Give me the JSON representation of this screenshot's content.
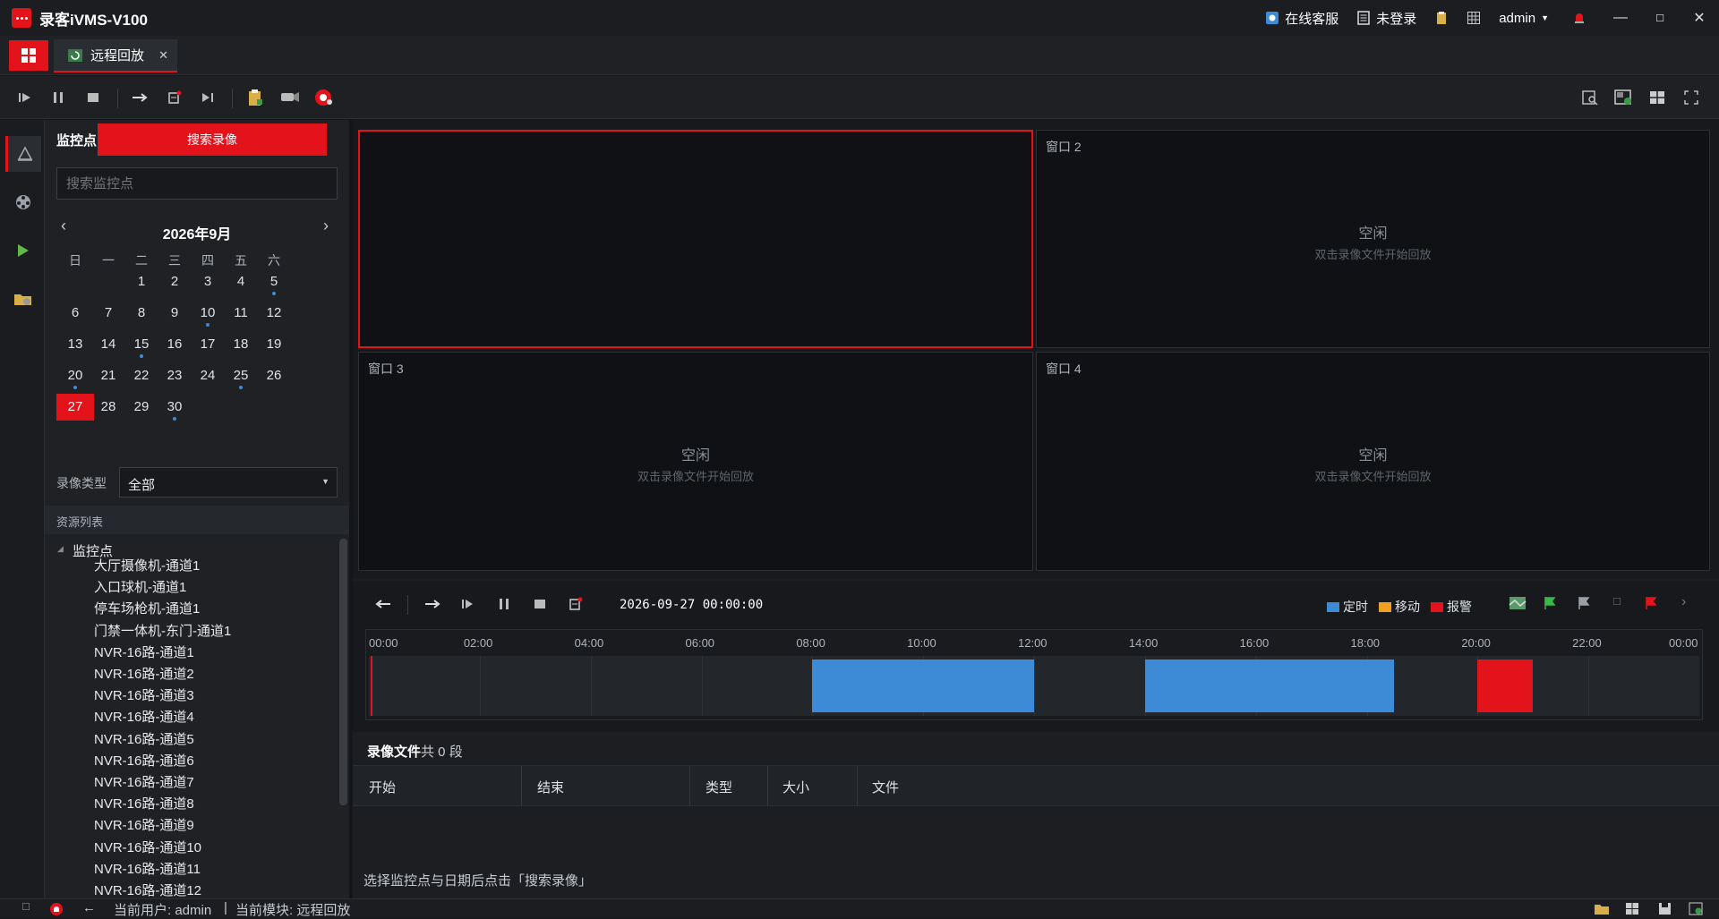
{
  "app": {
    "title": "录客iVMS-V100"
  },
  "titlebar": {
    "support": "在线客服",
    "login": "未登录",
    "user": "admin"
  },
  "tabs": [
    {
      "label": "远程回放"
    }
  ],
  "sidebar": {
    "header_label": "监控点",
    "search_button": "搜索录像",
    "search_placeholder": "搜索监控点",
    "calendar": {
      "month_title": "2026年9月",
      "weekdays": [
        "日",
        "一",
        "二",
        "三",
        "四",
        "五",
        "六"
      ],
      "days": [
        "1",
        "2",
        "3",
        "4",
        "5",
        "6",
        "7",
        "8",
        "9",
        "10",
        "11",
        "12",
        "13",
        "14",
        "15",
        "16",
        "17",
        "18",
        "19",
        "20",
        "21",
        "22",
        "23",
        "24",
        "25",
        "26",
        "27",
        "28",
        "29",
        "30"
      ],
      "selected_day": "27",
      "days_with_records": [
        "5",
        "10",
        "15",
        "20",
        "25",
        "30"
      ]
    },
    "record_type_label": "录像类型",
    "record_type_value": "全部",
    "resource_list_title": "资源列表",
    "tree_root": "监控点",
    "tree_items": [
      "大厅摄像机-通道1",
      "入口球机-通道1",
      "停车场枪机-通道1",
      "门禁一体机-东门-通道1",
      "NVR-16路-通道1",
      "NVR-16路-通道2",
      "NVR-16路-通道3",
      "NVR-16路-通道4",
      "NVR-16路-通道5",
      "NVR-16路-通道6",
      "NVR-16路-通道7",
      "NVR-16路-通道8",
      "NVR-16路-通道9",
      "NVR-16路-通道10",
      "NVR-16路-通道11",
      "NVR-16路-通道12"
    ]
  },
  "video": {
    "windows": [
      {
        "label": ""
      },
      {
        "label": "窗口 2",
        "idle": "空闲",
        "hint": "双击录像文件开始回放"
      },
      {
        "label": "窗口 3",
        "idle": "空闲",
        "hint": "双击录像文件开始回放"
      },
      {
        "label": "窗口 4",
        "idle": "空闲",
        "hint": "双击录像文件开始回放"
      }
    ]
  },
  "playback": {
    "datetime": "2026-09-27 00:00:00",
    "legend": [
      {
        "label": "定时",
        "color": "#3d8bd6"
      },
      {
        "label": "移动",
        "color": "#f0a020"
      },
      {
        "label": "报警",
        "color": "#e3131c"
      }
    ]
  },
  "timeline": {
    "ticks": [
      "00:00",
      "02:00",
      "04:00",
      "06:00",
      "08:00",
      "10:00",
      "12:00",
      "14:00",
      "16:00",
      "18:00",
      "20:00",
      "22:00",
      "00:00"
    ],
    "segments": [
      {
        "type": "定时",
        "start_hour": 8.0,
        "end_hour": 12.0,
        "color": "#3d8bd6"
      },
      {
        "type": "定时",
        "start_hour": 14.0,
        "end_hour": 18.5,
        "color": "#3d8bd6"
      },
      {
        "type": "报警",
        "start_hour": 20.0,
        "end_hour": 21.0,
        "color": "#e3131c"
      }
    ]
  },
  "files": {
    "title": "录像文件",
    "count_text": "共 0 段",
    "columns": [
      "开始",
      "结束",
      "类型",
      "大小",
      "文件"
    ],
    "rows": [],
    "hint": "选择监控点与日期后点击「搜索录像」"
  },
  "statusbar": {
    "user": "当前用户: admin",
    "separator": "|",
    "module": "当前模块: 远程回放"
  }
}
